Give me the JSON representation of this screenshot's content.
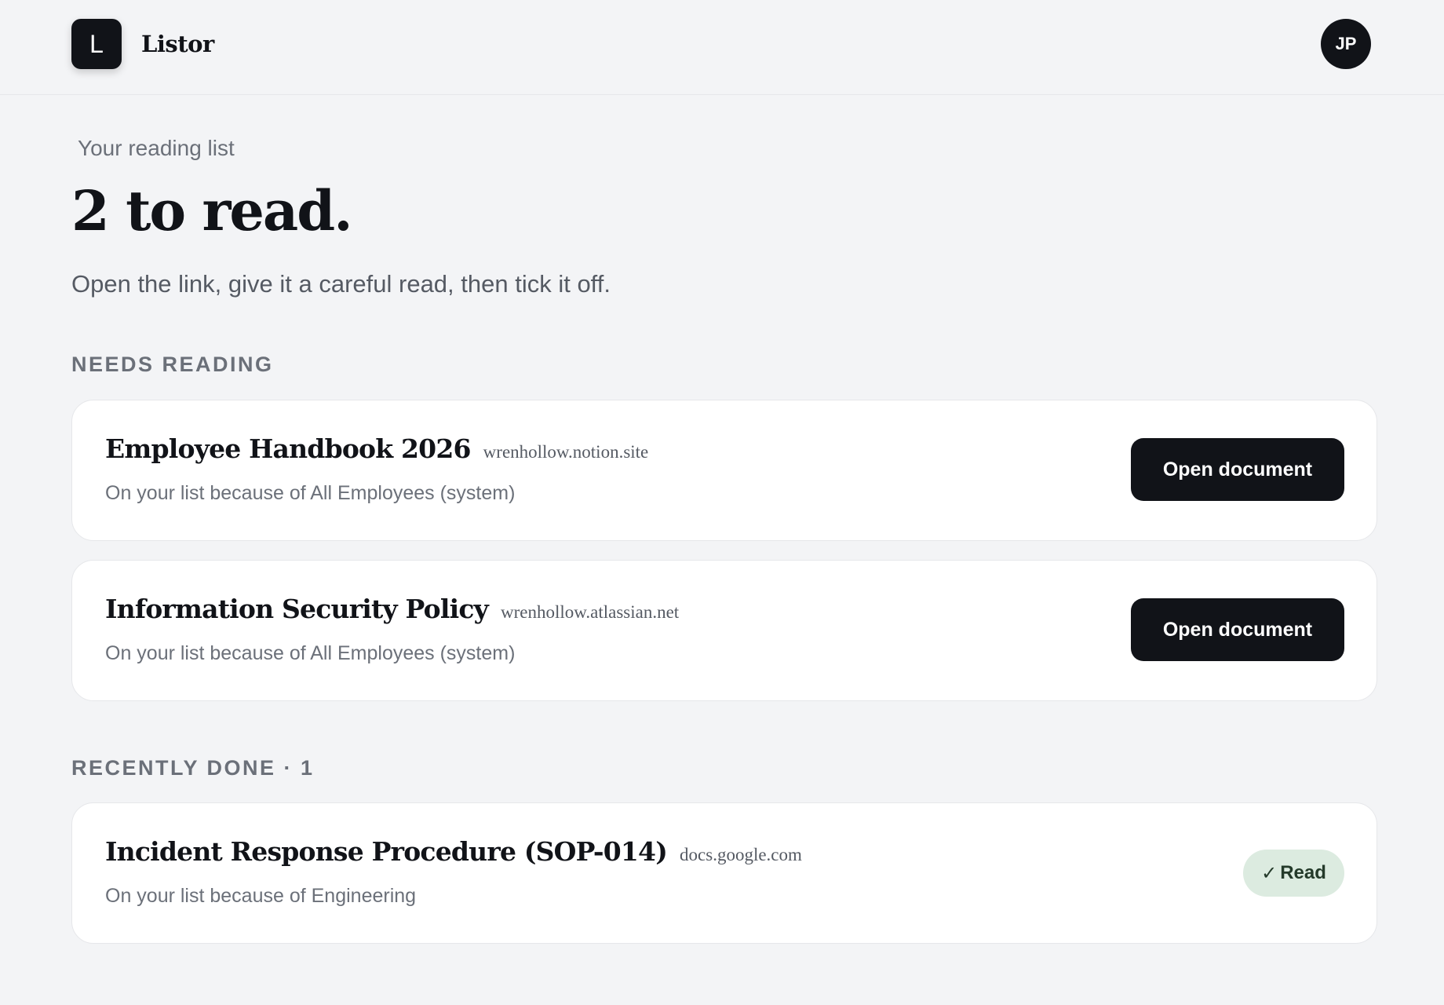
{
  "app": {
    "logo_letter": "L",
    "name": "Listor"
  },
  "user": {
    "initials": "JP"
  },
  "page": {
    "kicker": "Your reading list",
    "headline": "2 to read.",
    "subtext": "Open the link, give it a careful read, then tick it off."
  },
  "sections": {
    "needs_reading": {
      "label": "NEEDS READING",
      "items": [
        {
          "title": "Employee Handbook 2026",
          "domain": "wrenhollow.notion.site",
          "reason": "On your list because of All Employees (system)",
          "action": "Open document"
        },
        {
          "title": "Information Security Policy",
          "domain": "wrenhollow.atlassian.net",
          "reason": "On your list because of All Employees (system)",
          "action": "Open document"
        }
      ]
    },
    "recently_done": {
      "label": "RECENTLY DONE · 1",
      "items": [
        {
          "title": "Incident Response Procedure (SOP-014)",
          "domain": "docs.google.com",
          "reason": "On your list because of Engineering",
          "status_icon": "✓",
          "status": "Read"
        }
      ]
    }
  },
  "icons": {
    "check": "check-icon"
  },
  "colors": {
    "primary": "#111318",
    "background": "#f3f4f6",
    "read_badge_bg": "#dcebe0"
  }
}
